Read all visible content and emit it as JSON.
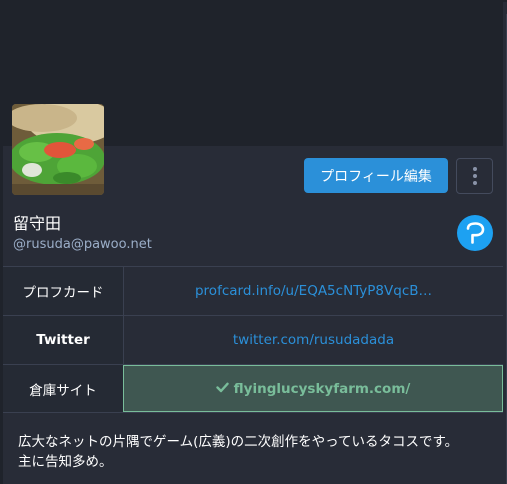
{
  "profile": {
    "display_name": "留守田",
    "acct": "@rusuda@pawoo.net",
    "edit_button": "プロフィール編集",
    "bio_line1": "広大なネットの片隅でゲーム(広義)の二次創作をやっているタコスです。",
    "bio_line2": "主に告知多め。"
  },
  "icons": {
    "more": "more-vertical-icon",
    "instance": "pawoo-logo-icon",
    "verified": "check-icon"
  },
  "fields": [
    {
      "name": "プロフカード",
      "value": "profcard.info/u/EQA5cNTyP8VqcB…",
      "verified": false
    },
    {
      "name": "Twitter",
      "value": "twitter.com/rusudadada",
      "verified": false
    },
    {
      "name": "倉庫サイト",
      "value": "flyinglucyskyfarm.com/",
      "verified": true
    }
  ],
  "colors": {
    "background": "#282c37",
    "accent": "#2b90d9",
    "verified": "#79bd9a"
  }
}
